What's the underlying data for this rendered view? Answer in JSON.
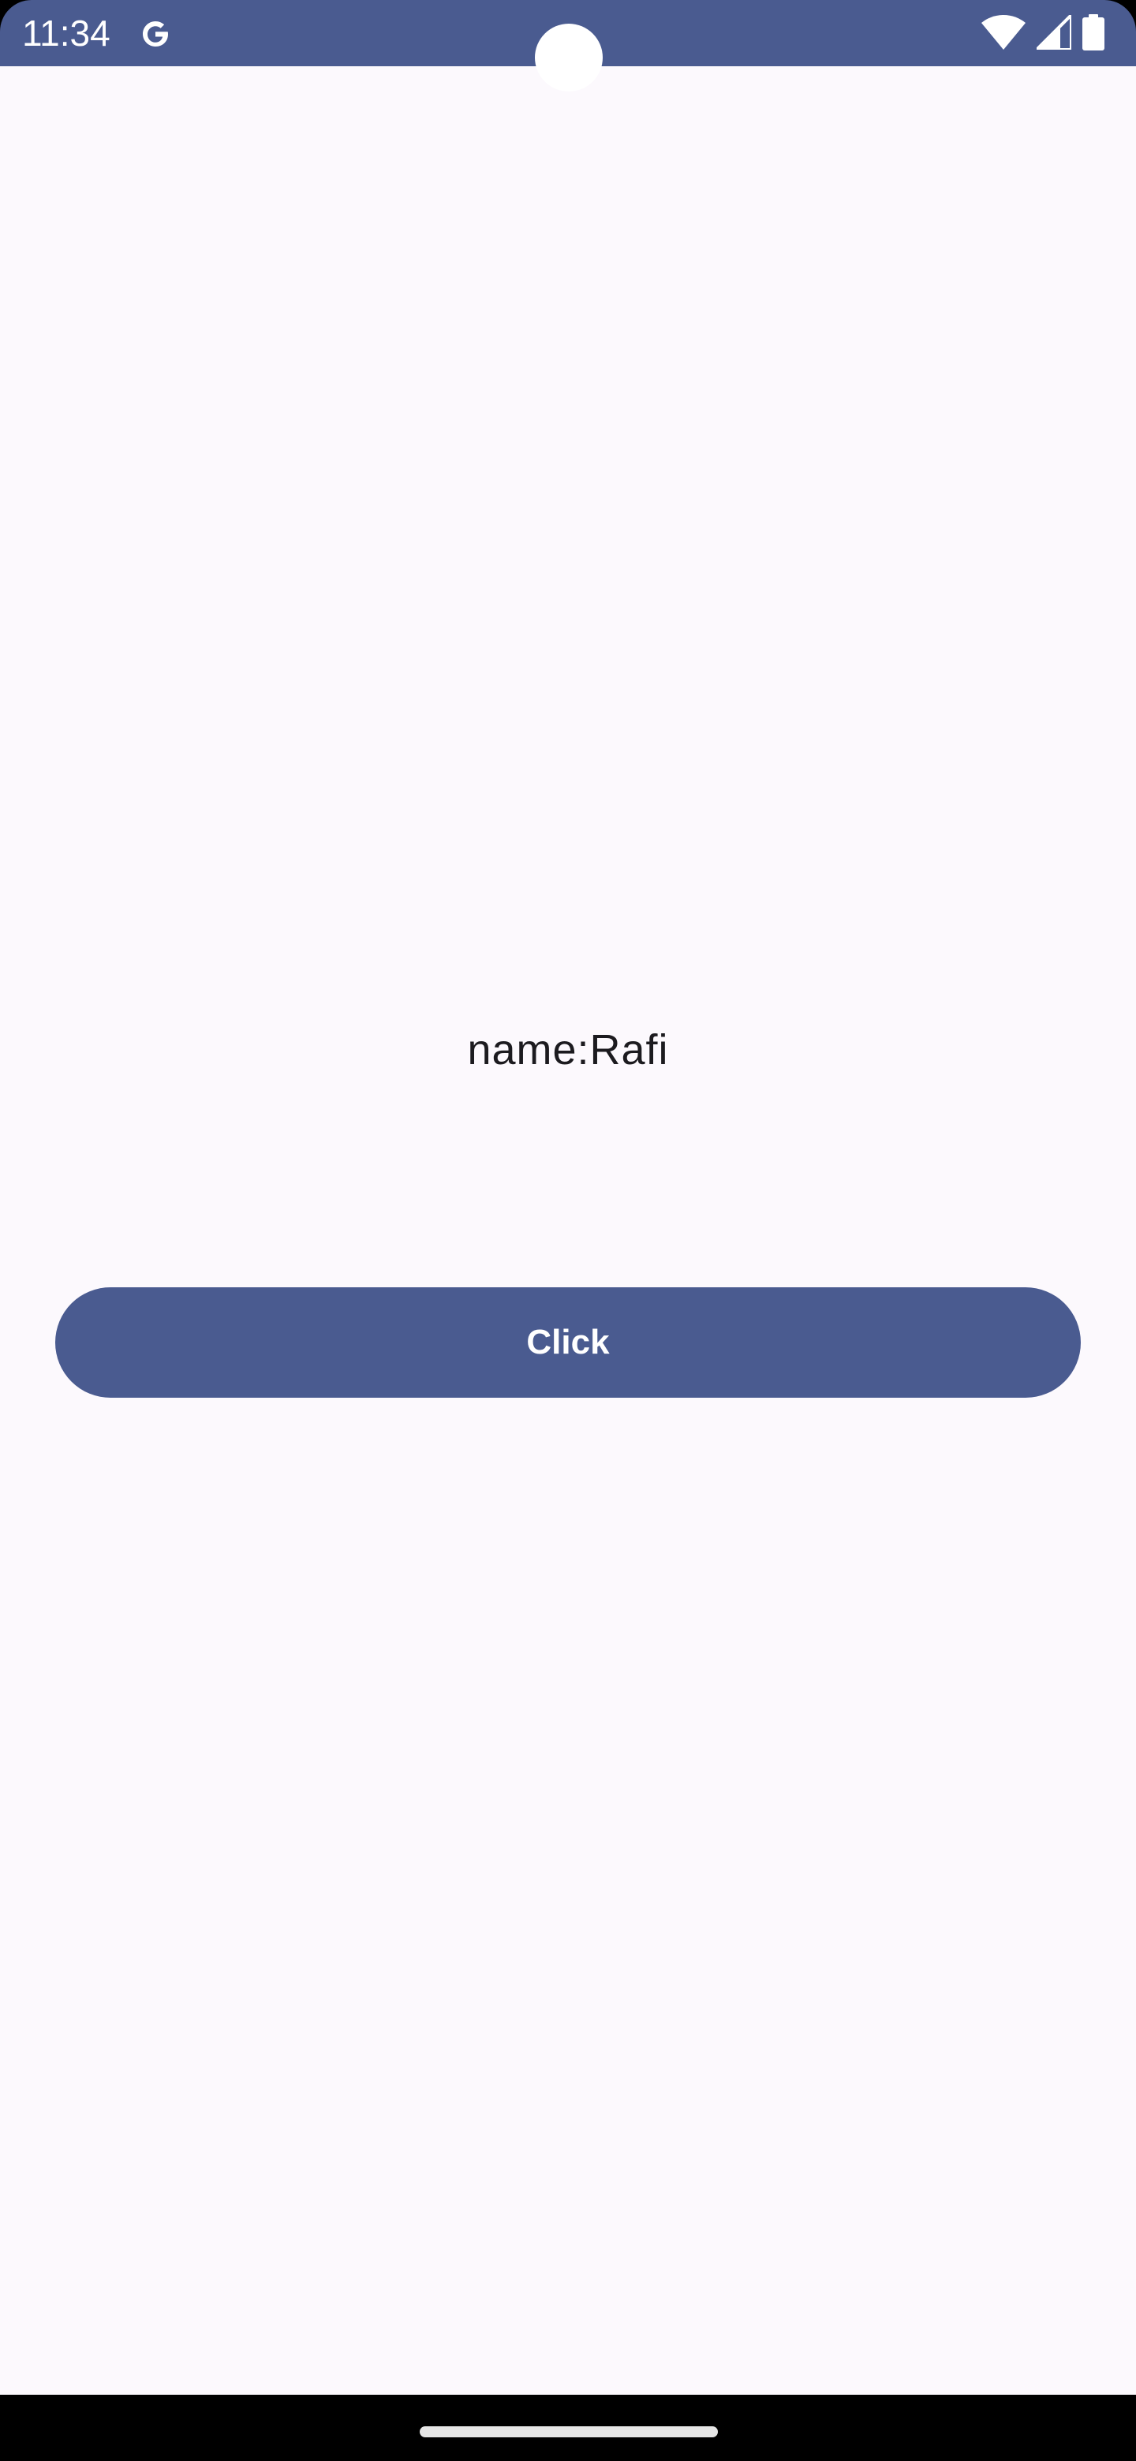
{
  "status_bar": {
    "time": "11:34",
    "background_color": "#4a5b90",
    "icons": [
      "google-icon",
      "wifi-icon",
      "cellular-signal-icon",
      "battery-icon"
    ]
  },
  "main": {
    "name_label": "name:Rafi",
    "click_button_label": "Click",
    "button_color": "#4a5b90",
    "background_color": "#fcf9fd"
  },
  "navigation_bar": {
    "handle_icon": "home-gesture-handle"
  }
}
